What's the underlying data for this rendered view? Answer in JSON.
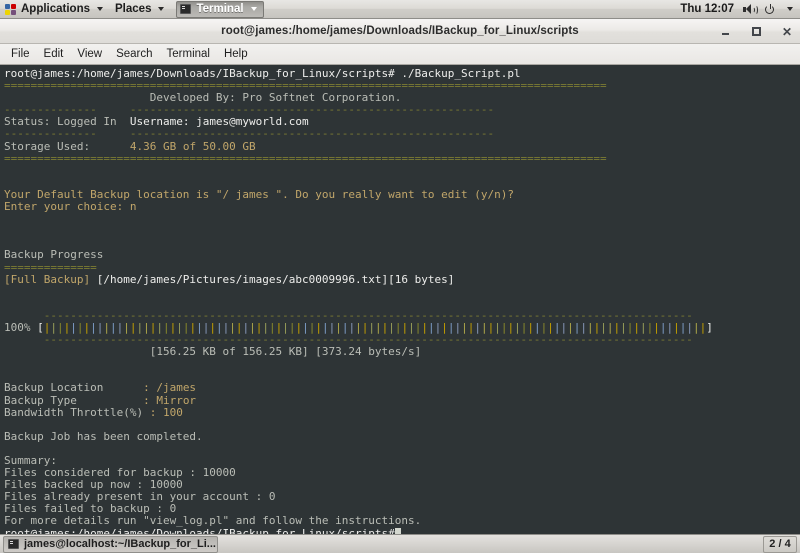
{
  "desktop": {
    "top_panel": {
      "applications_label": "Applications",
      "places_label": "Places",
      "window_list_label": "Terminal",
      "clock": "Thu 12:07",
      "icons": [
        "applications-menu-icon",
        "volume-icon",
        "power-icon"
      ]
    },
    "bottom_panel": {
      "task_label": "james@localhost:~/IBackup_for_Li...",
      "workspace": "2 / 4"
    }
  },
  "window": {
    "title": "root@james:/home/james/Downloads/IBackup_for_Linux/scripts",
    "buttons": {
      "minimize": "–",
      "maximize": "□",
      "close": "✕"
    },
    "menu": [
      "File",
      "Edit",
      "View",
      "Search",
      "Terminal",
      "Help"
    ]
  },
  "terminal": {
    "colors": {
      "background": "#2e3436",
      "foreground": "#d3d7cf",
      "prompt": "#eeeeec",
      "separator": "#7d7d33",
      "label": "#babdb6",
      "value": "#c1a66a"
    },
    "lines": [
      {
        "segments": [
          {
            "t": "root@james:/home/james/Downloads/IBackup_for_Linux/scripts# ./Backup_Script.pl",
            "c": "c-white"
          }
        ]
      },
      {
        "segments": [
          {
            "t": "===========================================================================================",
            "c": "c-sep"
          }
        ]
      },
      {
        "segments": [
          {
            "t": "                      Developed By: Pro Softnet Corporation.",
            "c": "c-gray"
          }
        ]
      },
      {
        "segments": [
          {
            "t": "--------------     ",
            "c": "c-sep"
          },
          {
            "t": "-------------------------------------------------------",
            "c": "c-sep"
          }
        ]
      },
      {
        "segments": [
          {
            "t": "Status: Logged In  ",
            "c": "c-gray"
          },
          {
            "t": "Username: james@myworld.com",
            "c": "c-white"
          }
        ]
      },
      {
        "segments": [
          {
            "t": "--------------     ",
            "c": "c-sep"
          },
          {
            "t": "-------------------------------------------------------",
            "c": "c-sep"
          }
        ]
      },
      {
        "segments": [
          {
            "t": "Storage Used:      ",
            "c": "c-gray"
          },
          {
            "t": "4.36 GB of 50.00 GB",
            "c": "c-tan"
          }
        ]
      },
      {
        "segments": [
          {
            "t": "===========================================================================================",
            "c": "c-sep"
          }
        ]
      },
      {
        "segments": [
          {
            "t": "",
            "c": "c-gray"
          }
        ]
      },
      {
        "segments": [
          {
            "t": "",
            "c": "c-gray"
          }
        ]
      },
      {
        "segments": [
          {
            "t": "Your Default Backup location is \"/ james \". Do you really want to edit (y/n)?",
            "c": "c-tan"
          }
        ]
      },
      {
        "segments": [
          {
            "t": "Enter your choice: n",
            "c": "c-tan"
          }
        ]
      },
      {
        "segments": [
          {
            "t": "",
            "c": "c-gray"
          }
        ]
      },
      {
        "segments": [
          {
            "t": "",
            "c": "c-gray"
          }
        ]
      },
      {
        "segments": [
          {
            "t": "",
            "c": "c-gray"
          }
        ]
      },
      {
        "segments": [
          {
            "t": "Backup Progress",
            "c": "c-gray"
          }
        ]
      },
      {
        "segments": [
          {
            "t": "==============",
            "c": "c-sep"
          }
        ]
      },
      {
        "segments": [
          {
            "t": "[Full Backup] ",
            "c": "c-tan"
          },
          {
            "t": "[/home/james/Pictures/images/abc0009996.txt][16 bytes]",
            "c": "c-white"
          }
        ]
      },
      {
        "segments": [
          {
            "t": "",
            "c": "c-gray"
          }
        ]
      },
      {
        "segments": [
          {
            "t": "",
            "c": "c-gray"
          }
        ]
      },
      {
        "segments": [
          {
            "t": "      --------------------------------------------------------------------------------------------------",
            "c": "c-sep"
          }
        ]
      },
      {
        "segments": [
          {
            "t": "100% ",
            "c": "c-gray"
          },
          {
            "t": "[",
            "c": "c-white"
          },
          {
            "t": "PROGRESS_BARS",
            "c": "c-bars"
          },
          {
            "t": "]",
            "c": "c-white"
          }
        ]
      },
      {
        "segments": [
          {
            "t": "      --------------------------------------------------------------------------------------------------",
            "c": "c-sep"
          }
        ]
      },
      {
        "segments": [
          {
            "t": "                      [156.25 KB of 156.25 KB] [373.24 bytes/s]",
            "c": "c-gray"
          }
        ]
      },
      {
        "segments": [
          {
            "t": "",
            "c": "c-gray"
          }
        ]
      },
      {
        "segments": [
          {
            "t": "",
            "c": "c-gray"
          }
        ]
      },
      {
        "segments": [
          {
            "t": "Backup Location      ",
            "c": "c-gray"
          },
          {
            "t": ": /james",
            "c": "c-tan"
          }
        ]
      },
      {
        "segments": [
          {
            "t": "Backup Type          ",
            "c": "c-gray"
          },
          {
            "t": ": Mirror",
            "c": "c-tan"
          }
        ]
      },
      {
        "segments": [
          {
            "t": "Bandwidth Throttle(%)",
            "c": "c-gray"
          },
          {
            "t": " : 100",
            "c": "c-tan"
          }
        ]
      },
      {
        "segments": [
          {
            "t": "",
            "c": "c-gray"
          }
        ]
      },
      {
        "segments": [
          {
            "t": "Backup Job has been completed.",
            "c": "c-gray"
          }
        ]
      },
      {
        "segments": [
          {
            "t": "",
            "c": "c-gray"
          }
        ]
      },
      {
        "segments": [
          {
            "t": "Summary:",
            "c": "c-gray"
          }
        ]
      },
      {
        "segments": [
          {
            "t": "Files considered for backup : 10000",
            "c": "c-gray"
          }
        ]
      },
      {
        "segments": [
          {
            "t": "Files backed up now : 10000",
            "c": "c-gray"
          }
        ]
      },
      {
        "segments": [
          {
            "t": "Files already present in your account : 0",
            "c": "c-gray"
          }
        ]
      },
      {
        "segments": [
          {
            "t": "Files failed to backup : 0",
            "c": "c-gray"
          }
        ]
      },
      {
        "segments": [
          {
            "t": "For more details run \"view_log.pl\" and follow the instructions.",
            "c": "c-gray"
          }
        ]
      },
      {
        "segments": [
          {
            "t": "root@james:/home/james/Downloads/IBackup_for_Linux/scripts#",
            "c": "c-white"
          },
          {
            "t": "CURSOR",
            "c": "cursor"
          }
        ]
      }
    ],
    "progress": {
      "percent": "100%",
      "bar_char": "|",
      "bar_count": 100,
      "transferred": "156.25 KB of 156.25 KB",
      "rate": "373.24 bytes/s"
    }
  }
}
